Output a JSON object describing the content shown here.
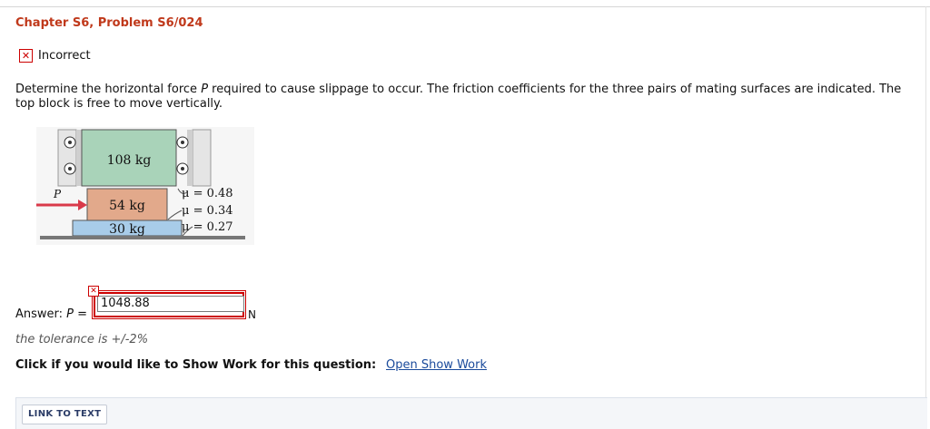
{
  "problem": {
    "title": "Chapter S6, Problem S6/024"
  },
  "status": {
    "icon": "x-icon",
    "label": "Incorrect",
    "color": "#cc0000"
  },
  "question": {
    "text_before": "Determine the horizontal force ",
    "variable": "P",
    "text_after": " required to cause slippage to occur. The friction coefficients for the three pairs of mating surfaces are indicated. The top block is free to move vertically."
  },
  "figure": {
    "blocks": [
      {
        "label": "108 kg",
        "color": "#a9d3b9"
      },
      {
        "label": "54 kg",
        "color": "#e2a98b"
      },
      {
        "label": "30 kg",
        "color": "#a8cce9"
      }
    ],
    "force_label": "P",
    "force_color": "#d93a4a",
    "friction": [
      "μ = 0.48",
      "μ = 0.34",
      "μ = 0.27"
    ]
  },
  "answer": {
    "label_prefix": "Answer: ",
    "variable": "P",
    "label_suffix": " =",
    "value": "1048.88",
    "unit": "N",
    "error_icon": "x-icon"
  },
  "tolerance": "the tolerance is +/-2%",
  "show_work": {
    "prompt": "Click if you would like to Show Work for this question:",
    "link": "Open Show Work"
  },
  "footer": {
    "link_to_text": "LINK TO TEXT"
  }
}
